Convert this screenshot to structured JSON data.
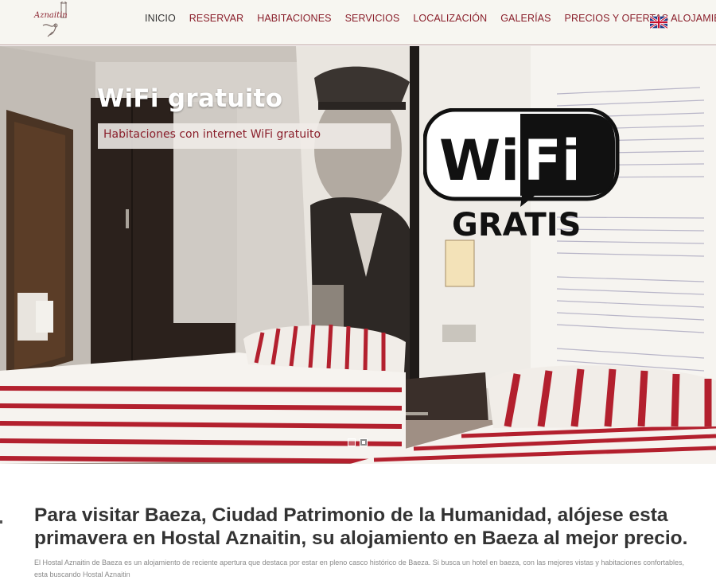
{
  "header": {
    "logo_text": "Aznaitin",
    "nav": [
      {
        "label": "INICIO"
      },
      {
        "label": "RESERVAR"
      },
      {
        "label": "HABITACIONES"
      },
      {
        "label": "SERVICIOS"
      },
      {
        "label": "LOCALIZACIÓN"
      },
      {
        "label": "GALERÍAS"
      },
      {
        "label": "PRECIOS Y OFERTAS ALOJAMIENTO"
      }
    ],
    "language_icon": "uk-flag-icon"
  },
  "slider": {
    "title": "WiFi gratuito",
    "subtitle": "Habitaciones con internet WiFi gratuito",
    "badge_word_1": "Wi",
    "badge_word_2": "Fi",
    "badge_caption": "GRATIS",
    "slide_count": 2,
    "active_slide": 2
  },
  "intro": {
    "heading": "Para visitar Baeza, Ciudad Patrimonio de la Humanidad, alójese esta primavera en Hostal Aznaitin, su alojamiento en Baeza al mejor precio.",
    "text": "El Hostal Aznaitin de Baeza es un alojamiento de reciente apertura que destaca por estar en pleno casco histórico de Baeza. Si busca un hotel en baeza, con las mejores vistas y habitaciones confortables, esta buscando Hostal Aznaitin"
  },
  "colors": {
    "accent": "#8a1f2b",
    "header_bg": "#f7f6f1",
    "stripe_red": "#b3202e"
  }
}
